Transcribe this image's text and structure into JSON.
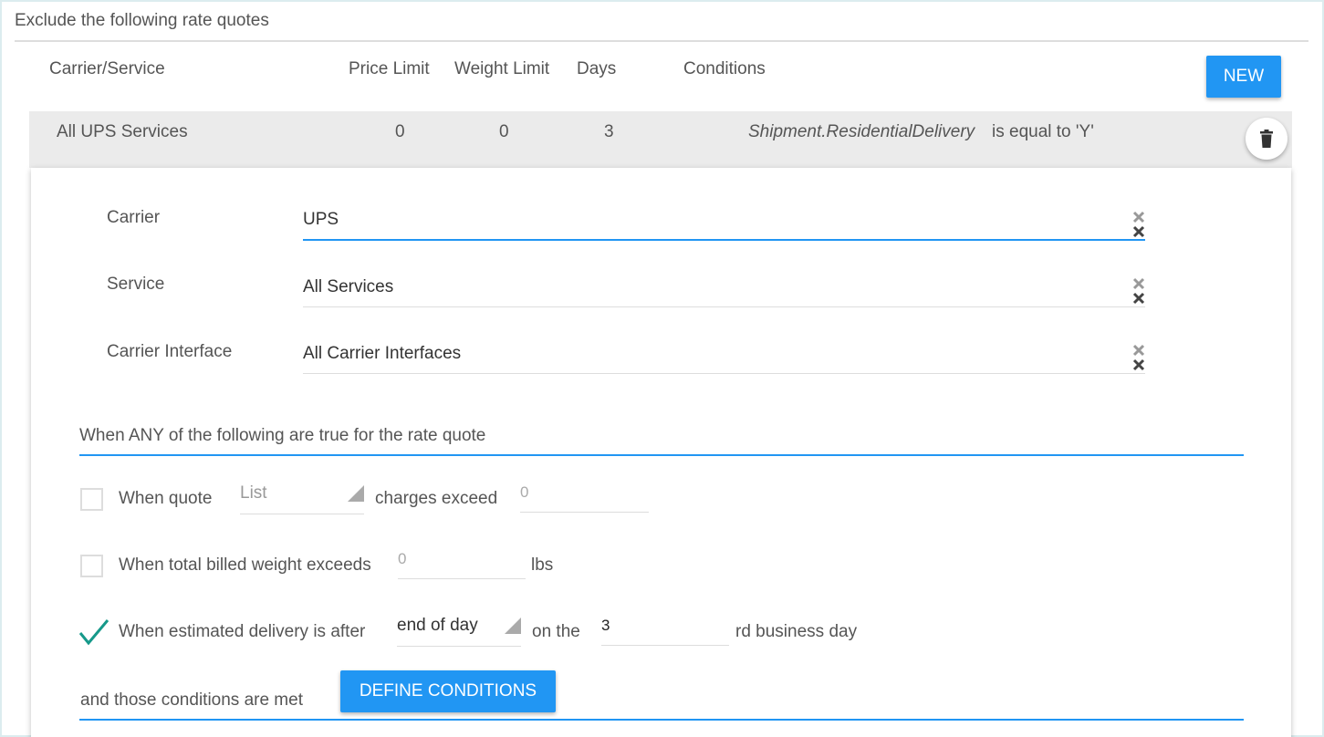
{
  "section": {
    "title": "Exclude the following rate quotes"
  },
  "columns": {
    "carrier_service": "Carrier/Service",
    "price_limit": "Price Limit",
    "weight_limit": "Weight Limit",
    "days": "Days",
    "conditions": "Conditions"
  },
  "new_button": "NEW",
  "row": {
    "carrier_service": "All UPS Services",
    "price_limit": "0",
    "weight_limit": "0",
    "days": "3",
    "condition_field": "Shipment.ResidentialDelivery",
    "condition_text": "is equal to 'Y'",
    "delete_icon": "trash-icon"
  },
  "form": {
    "carrier": {
      "label": "Carrier",
      "value": "UPS"
    },
    "service": {
      "label": "Service",
      "value": "All Services"
    },
    "carrier_interface": {
      "label": "Carrier Interface",
      "value": "All Carrier Interfaces"
    },
    "any_heading": "When ANY of the following are true for the rate quote",
    "quote_charges": {
      "checked": false,
      "prefix": "When quote",
      "select_value": "List",
      "middle": "charges exceed",
      "input_placeholder": "0"
    },
    "billed_weight": {
      "checked": false,
      "prefix": "When total billed weight exceeds",
      "input_placeholder": "0",
      "suffix": "lbs"
    },
    "delivery": {
      "checked": true,
      "prefix": "When estimated delivery is after",
      "select_value": "end of day",
      "middle": "on the",
      "input_value": "3",
      "suffix": "rd business day"
    },
    "conditions_met": "and those conditions are met",
    "define_button": "DEFINE CONDITIONS"
  },
  "colors": {
    "accent": "#2196f3",
    "check": "#16998a"
  }
}
